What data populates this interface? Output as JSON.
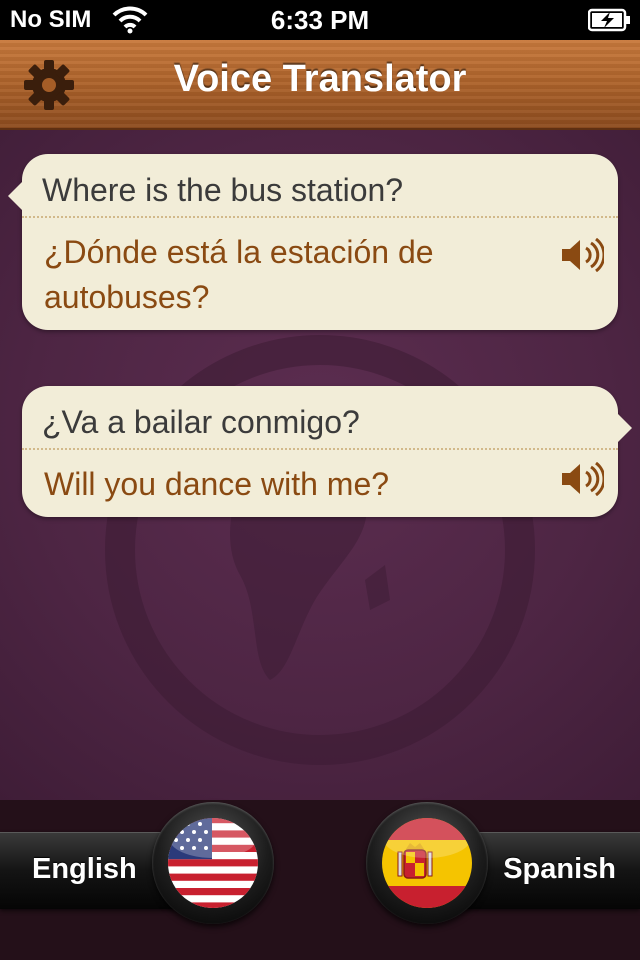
{
  "status_bar": {
    "carrier": "No SIM",
    "time": "6:33 PM"
  },
  "navbar": {
    "title": "Voice Translator",
    "settings_icon": "gear-icon"
  },
  "conversations": [
    {
      "source": "Where is the bus station?",
      "translation": "¿Dónde está la estación de autobuses?",
      "speaker_icon": "speaker-icon"
    },
    {
      "source": "¿Va a bailar conmigo?",
      "translation": "Will you dance with me?",
      "speaker_icon": "speaker-icon"
    }
  ],
  "languages": {
    "left": {
      "label": "English",
      "flag_icon": "us-flag-icon"
    },
    "right": {
      "label": "Spanish",
      "flag_icon": "spain-flag-icon"
    }
  },
  "colors": {
    "navbar_wood": "#b0652c",
    "background": "#4d2543",
    "bubble": "#f2edd8",
    "translation_text": "#8a4a12"
  }
}
